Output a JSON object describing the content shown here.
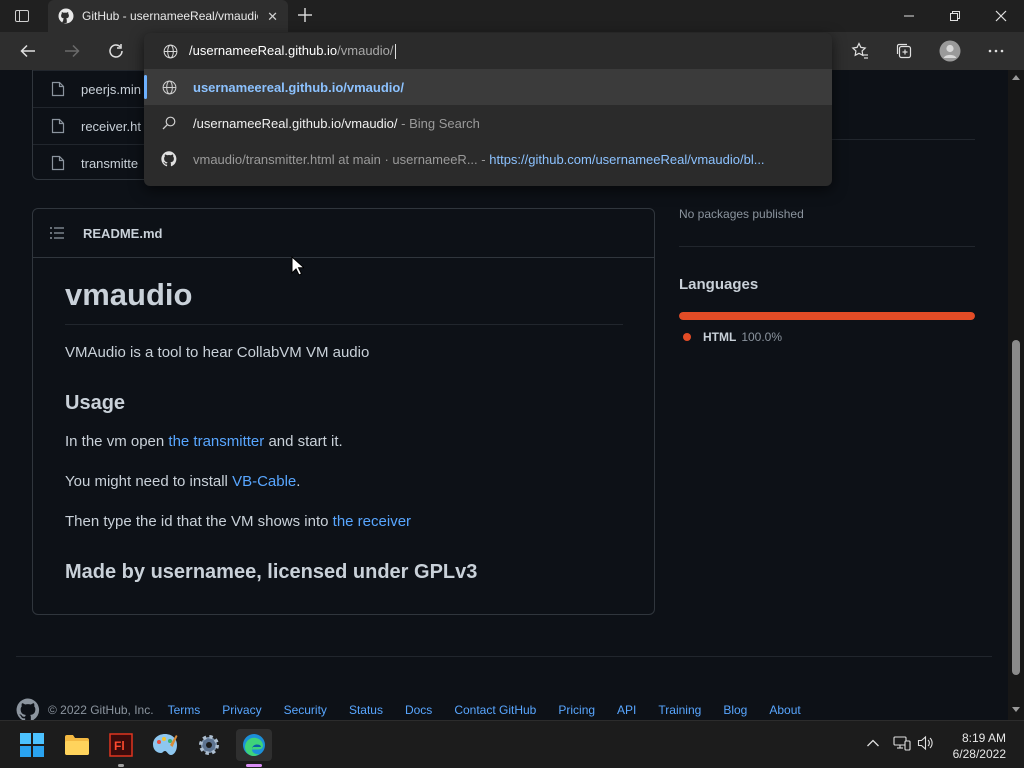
{
  "browser": {
    "tab_title": "GitHub - usernameeReal/vmaudio",
    "address": {
      "host": "/usernameeReal.github.io",
      "path": "/vmaudio/"
    }
  },
  "omnibox": {
    "suggestions": [
      {
        "text": "usernameereal.github.io/vmaudio/",
        "icon": "globe-icon"
      },
      {
        "text": "/usernameeReal.github.io/vmaudio/",
        "suffix": " - Bing Search",
        "icon": "search-icon"
      },
      {
        "text": "vmaudio/transmitter.html at main · usernameeR...",
        "sep": " - ",
        "url": "https://github.com/usernameeReal/vmaudio/bl...",
        "icon": "github-icon"
      }
    ]
  },
  "files": [
    {
      "name": "peerjs.min"
    },
    {
      "name": "receiver.ht"
    },
    {
      "name": "transmitte"
    }
  ],
  "readme": {
    "filename": "README.md",
    "title": "vmaudio",
    "description": "VMAudio is a tool to hear CollabVM VM audio",
    "usage_heading": "Usage",
    "line1": {
      "before": "In the vm open ",
      "link": "the transmitter",
      "after": " and start it."
    },
    "line2": {
      "before": "You might need to install ",
      "link": "VB-Cable",
      "after": "."
    },
    "line3": {
      "before": "Then type the id that the VM shows into ",
      "link": "the receiver"
    },
    "made_by": "Made by usernamee, licensed under GPLv3"
  },
  "sidebar": {
    "packages_text": "No packages published",
    "languages_heading": "Languages",
    "language": {
      "name": "HTML",
      "percent": "100.0%",
      "share": 100,
      "color": "#e34c26"
    }
  },
  "footer": {
    "copyright": "© 2022 GitHub, Inc.",
    "links": [
      "Terms",
      "Privacy",
      "Security",
      "Status",
      "Docs",
      "Contact GitHub",
      "Pricing",
      "API",
      "Training",
      "Blog",
      "About"
    ]
  },
  "taskbar": {
    "time": "8:19 AM",
    "date": "6/28/2022"
  }
}
